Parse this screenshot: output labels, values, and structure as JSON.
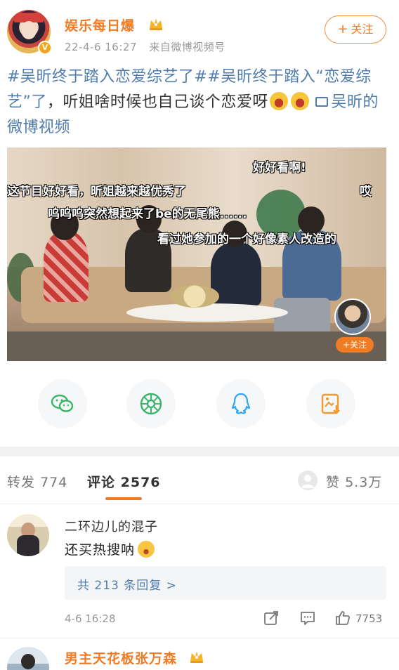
{
  "post": {
    "username": "娱乐每日爆",
    "date": "22-4-6 16:27",
    "source": "来自微博视频号",
    "follow_label": "关注",
    "text": {
      "topic1": "#吴昕终于踏入恋爱综艺了#",
      "topic2": "吴昕终于踏入“恋爱综艺”了",
      "body": "，听姐啥时候也自己谈个恋爱呀",
      "video_link": "吴昕的微博视频"
    }
  },
  "video": {
    "danmaku": [
      "好好看啊!",
      "这节目好好看，昕姐越来越优秀了",
      "哎",
      "呜呜呜突然想起来了be的无尾熊......",
      "看过她参加的一个好像素人改造的"
    ],
    "follow_chip": "+关注"
  },
  "share": {
    "icons": [
      "wechat-icon",
      "moments-icon",
      "qq-icon",
      "save-image-icon"
    ]
  },
  "tabs": {
    "repost_label": "转发",
    "repost_count": "774",
    "comment_label": "评论",
    "comment_count": "2576",
    "like_label": "赞",
    "like_count": "5.3万"
  },
  "comment": {
    "username": "二环边儿的混子",
    "text": "还买热搜呐",
    "replies": "共 213 条回复 >",
    "time": "4-6 16:28",
    "likes": "7753"
  },
  "next_comment": {
    "username": "男主天花板张万森"
  },
  "colors": {
    "accent": "#f07b25",
    "link": "#507daf"
  }
}
